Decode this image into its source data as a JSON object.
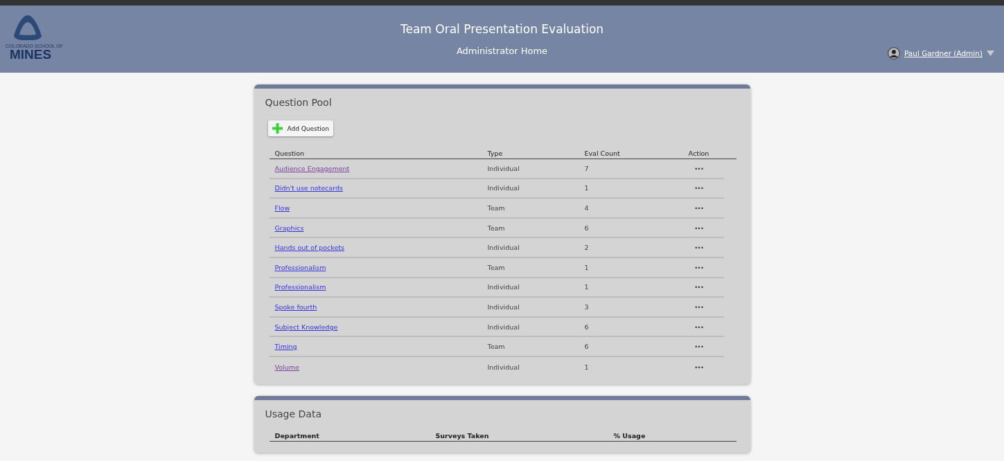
{
  "header": {
    "logo_subtext": "COLORADO SCHOOL OF",
    "logo_text": "MINES",
    "title": "Team Oral Presentation Evaluation",
    "subtitle": "Administrator Home",
    "user": "Paul Gardner (Admin)"
  },
  "question_pool": {
    "title": "Question Pool",
    "add_button": "Add Question",
    "columns": [
      "Question",
      "Type",
      "Eval Count",
      "Action"
    ],
    "rows": [
      {
        "question": "Audience Engagement",
        "visited": true,
        "type": "Individual",
        "eval_count": "7",
        "action": "•••"
      },
      {
        "question": "Didn't use notecards",
        "visited": false,
        "type": "Individual",
        "eval_count": "1",
        "action": "•••"
      },
      {
        "question": "Flow",
        "visited": false,
        "type": "Team",
        "eval_count": "4",
        "action": "•••"
      },
      {
        "question": "Graphics",
        "visited": false,
        "type": "Team",
        "eval_count": "6",
        "action": "•••"
      },
      {
        "question": "Hands out of pockets",
        "visited": false,
        "type": "Individual",
        "eval_count": "2",
        "action": "•••"
      },
      {
        "question": "Professionalism",
        "visited": false,
        "type": "Team",
        "eval_count": "1",
        "action": "•••"
      },
      {
        "question": "Professionalism",
        "visited": false,
        "type": "Individual",
        "eval_count": "1",
        "action": "•••"
      },
      {
        "question": "Spoke fourth",
        "visited": false,
        "type": "Individual",
        "eval_count": "3",
        "action": "•••"
      },
      {
        "question": "Subject Knowledge",
        "visited": false,
        "type": "Individual",
        "eval_count": "6",
        "action": "•••"
      },
      {
        "question": "Timing",
        "visited": false,
        "type": "Team",
        "eval_count": "6",
        "action": "•••"
      },
      {
        "question": "Volume",
        "visited": true,
        "type": "Individual",
        "eval_count": "1",
        "action": "•••"
      }
    ]
  },
  "usage_data": {
    "title": "Usage Data",
    "columns": [
      "Department",
      "Surveys Taken",
      "% Usage"
    ]
  }
}
